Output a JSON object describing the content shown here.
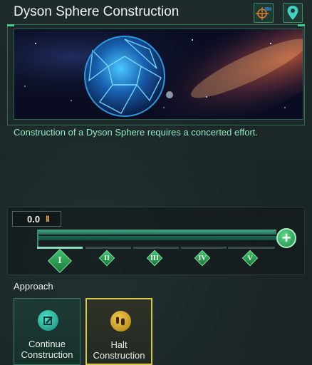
{
  "window": {
    "title": "Dyson Sphere Construction",
    "description": "Construction of a Dyson Sphere requires a concerted effort."
  },
  "header_icons": [
    {
      "name": "locate-target-icon"
    },
    {
      "name": "map-pin-icon"
    }
  ],
  "progress": {
    "value_display": "0.0",
    "pause_symbol": "II",
    "current_stage": 1,
    "stage_fill_fraction": 1.0,
    "stages": [
      "I",
      "II",
      "III",
      "IV",
      "V"
    ]
  },
  "approach": {
    "label": "Approach",
    "options": [
      {
        "line1": "Continue",
        "line2": "Construction",
        "icon": "construction-icon",
        "selected": false
      },
      {
        "line1": "Halt",
        "line2": "Construction",
        "icon": "halt-icon",
        "selected": true
      }
    ]
  },
  "colors": {
    "accent_green": "#3fd08a",
    "description_text": "#8fe8c4",
    "selected_border": "#d8c84a",
    "pause_orange": "#e8a040"
  }
}
